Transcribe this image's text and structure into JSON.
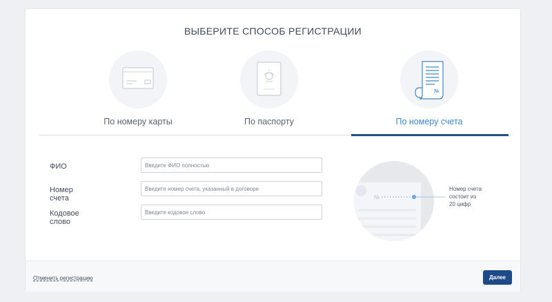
{
  "page": {
    "title": "ВЫБЕРИТЕ СПОСОБ РЕГИСТРАЦИИ"
  },
  "tabs": [
    {
      "label": "По номеру карты",
      "icon": "credit-card-icon",
      "active": false
    },
    {
      "label": "По паспорту",
      "icon": "passport-icon",
      "active": false
    },
    {
      "label": "По номеру счета",
      "icon": "document-icon",
      "active": true
    }
  ],
  "form": {
    "fields": [
      {
        "label": "ФИО",
        "placeholder": "Введите ФИО полностью",
        "value": ""
      },
      {
        "label": "Номер счета",
        "placeholder": "Введите номер счета, указанный в договоре",
        "value": ""
      },
      {
        "label": "Кодовое слово",
        "placeholder": "Введите кодовое слово",
        "value": ""
      }
    ]
  },
  "illustration": {
    "symbol": "№",
    "callout_lines": [
      "Номер счета",
      "состоит из",
      "20 цифр"
    ]
  },
  "footer": {
    "cancel_label": "Отменить регистрацию",
    "next_label": "Далее"
  },
  "colors": {
    "accent": "#3c86c9",
    "primary_button": "#1f4a89",
    "active_underline": "#234f8a"
  }
}
